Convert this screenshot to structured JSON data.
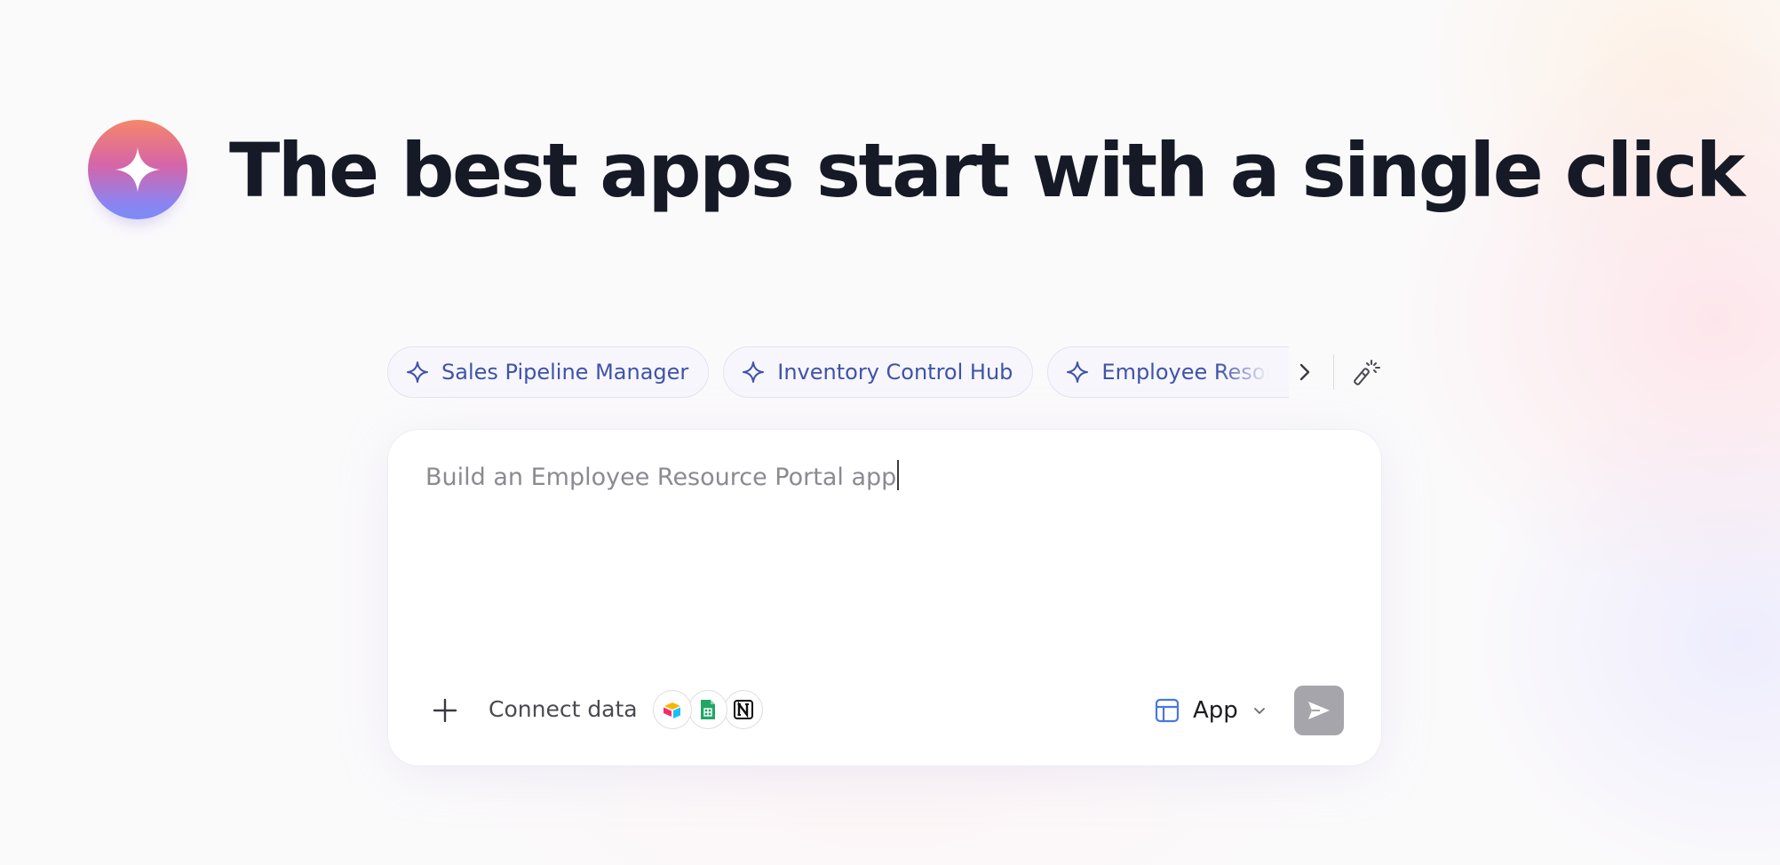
{
  "hero": {
    "title": "The best apps start with a single click"
  },
  "suggestions": [
    {
      "label": "Sales Pipeline Manager",
      "icon": "sparkle-icon"
    },
    {
      "label": "Inventory Control Hub",
      "icon": "sparkle-icon"
    },
    {
      "label": "Employee Resource Portal",
      "icon": "sparkle-icon"
    }
  ],
  "suggestions_controls": {
    "next_icon": "chevron-right-icon",
    "wand_icon": "magic-wand-icon"
  },
  "prompt": {
    "value": "Build an Employee Resource Portal app"
  },
  "toolbar": {
    "add_icon": "plus-icon",
    "connect_label": "Connect data",
    "integrations": [
      "airtable-icon",
      "google-sheets-icon",
      "notion-icon"
    ],
    "mode_label": "App",
    "mode_icon": "layout-icon",
    "send_icon": "send-icon"
  },
  "colors": {
    "accent": "#4053a9",
    "title": "#161a26",
    "send_disabled": "#a5a5ab"
  }
}
